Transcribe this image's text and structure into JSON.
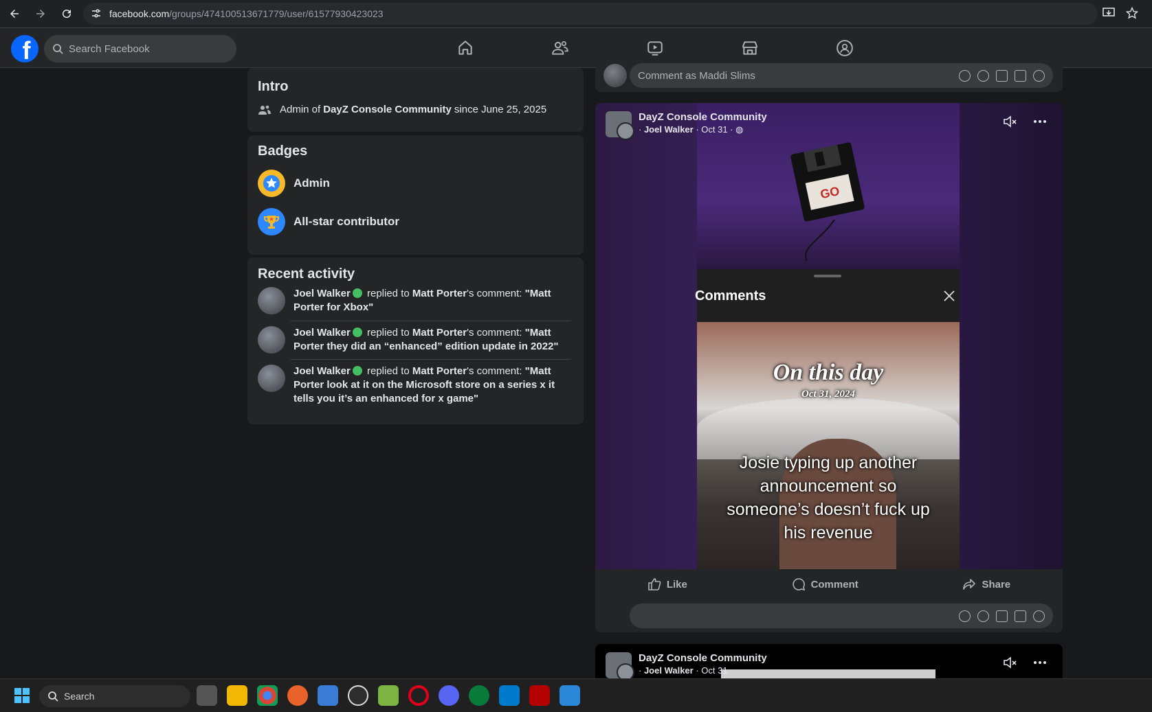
{
  "browser": {
    "url_domain": "facebook.com",
    "url_path": "/groups/474100513671779/user/61577930423023"
  },
  "fb": {
    "search_placeholder": "Search Facebook",
    "nav": [
      "home-icon",
      "friends-icon",
      "video-icon",
      "marketplace-icon",
      "groups-icon"
    ]
  },
  "intro": {
    "title": "Intro",
    "prefix": "Admin of",
    "group": "DayZ Console Community",
    "suffix": "since June 25, 2025"
  },
  "badges": {
    "title": "Badges",
    "items": [
      {
        "label": "Admin",
        "color": "#f7b928"
      },
      {
        "label": "All-star contributor",
        "color": "#2d88ff"
      }
    ]
  },
  "recent": {
    "title": "Recent activity",
    "items": [
      {
        "user": "Joel Walker",
        "verb": "replied to",
        "target": "Matt Porter",
        "rest": "'s comment:",
        "quote": "\"Matt Porter for Xbox\""
      },
      {
        "user": "Joel Walker",
        "verb": "replied to",
        "target": "Matt Porter",
        "rest": "'s comment:",
        "quote": "\"Matt Porter they did an “enhanced” edition update in 2022\""
      },
      {
        "user": "Joel Walker",
        "verb": "replied to",
        "target": "Matt Porter",
        "rest": "'s comment:",
        "quote": "\"Matt Porter look at it on the Microsoft store on a series x it tells you it’s an enhanced for x game\""
      }
    ]
  },
  "top_comment": {
    "placeholder": "Comment as Maddi Slims"
  },
  "post1": {
    "group": "DayZ Console Community",
    "author": "Joel Walker",
    "date": "Oct 31",
    "comments_title": "Comments",
    "overlay_title": "On this day",
    "overlay_date": "Oct 31, 2024",
    "caption": "Josie typing up another announcement so someone’s doesn’t fuck up his revenue",
    "like": "Like",
    "comment": "Comment",
    "share": "Share"
  },
  "post2": {
    "group": "DayZ Console Community",
    "author": "Joel Walker",
    "date": "Oct 31"
  },
  "taskbar": {
    "search": "Search"
  }
}
